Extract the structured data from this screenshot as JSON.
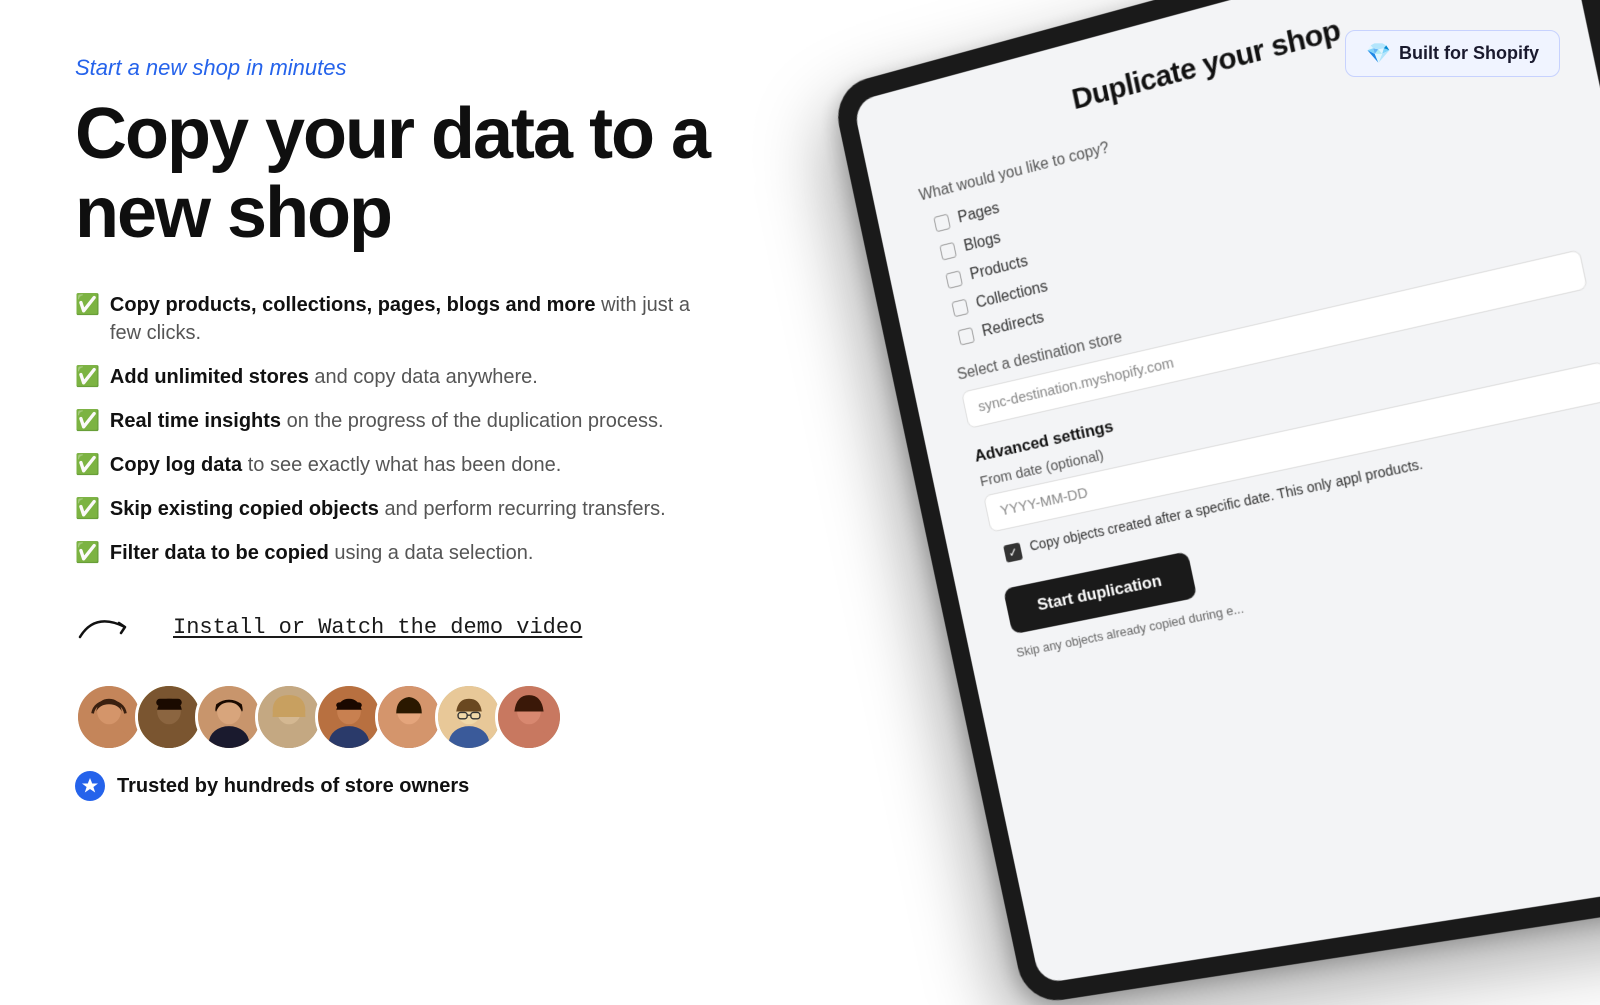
{
  "header": {
    "tagline": "Start a new shop in minutes",
    "main_title": "Copy your data to a new shop",
    "shopify_badge": "Built for Shopify"
  },
  "features": [
    {
      "bold": "Copy products, collections, pages, blogs and more",
      "light": " with just a few clicks."
    },
    {
      "bold": "Add unlimited stores",
      "light": " and copy data anywhere."
    },
    {
      "bold": "Real time insights",
      "light": " on the progress of the duplication process."
    },
    {
      "bold": "Copy log data",
      "light": " to see exactly what has been done."
    },
    {
      "bold": "Skip existing copied objects",
      "light": " and perform recurring transfers."
    },
    {
      "bold": "Filter data to be copied",
      "light": " using a data selection."
    }
  ],
  "demo": {
    "text": "Install or Watch the demo video"
  },
  "trusted": {
    "text": "Trusted by hundreds of store owners"
  },
  "tablet": {
    "title": "Duplicate your shop",
    "what_to_copy_label": "What would you like to copy?",
    "checkboxes": [
      {
        "label": "Pages",
        "checked": false
      },
      {
        "label": "Blogs",
        "checked": false
      },
      {
        "label": "Products",
        "checked": false
      },
      {
        "label": "Collections",
        "checked": false
      },
      {
        "label": "Redirects",
        "checked": false
      }
    ],
    "destination_label": "Select a destination store",
    "destination_placeholder": "sync-destination.myshopify.com",
    "advanced_settings": "Advanced settings",
    "from_date_label": "From date (optional)",
    "from_date_placeholder": "YYYY-MM-DD",
    "copy_objects_text": "Copy objects created after a specific date. This only appl products.",
    "skip_label": "Skip any objects already copied during e...",
    "start_button": "Start duplication"
  },
  "avatars": [
    {
      "id": 1,
      "emoji": "👩"
    },
    {
      "id": 2,
      "emoji": "👨"
    },
    {
      "id": 3,
      "emoji": "👦"
    },
    {
      "id": 4,
      "emoji": "🧕"
    },
    {
      "id": 5,
      "emoji": "👨"
    },
    {
      "id": 6,
      "emoji": "👩"
    },
    {
      "id": 7,
      "emoji": "👓"
    },
    {
      "id": 8,
      "emoji": "👩"
    }
  ]
}
